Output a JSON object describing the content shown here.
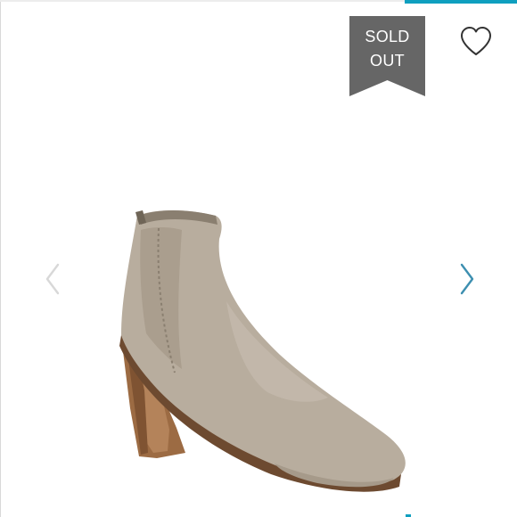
{
  "badge": {
    "line1": "SOLD",
    "line2": "OUT"
  },
  "icons": {
    "favorite": "heart-icon",
    "previous": "chevron-left-icon",
    "next": "chevron-right-icon"
  },
  "colors": {
    "accent": "#0f9fbf",
    "badge_bg": "#666666",
    "badge_text": "#ffffff",
    "suede": "#b8ad9e",
    "heel_wood": "#9c6b43"
  }
}
